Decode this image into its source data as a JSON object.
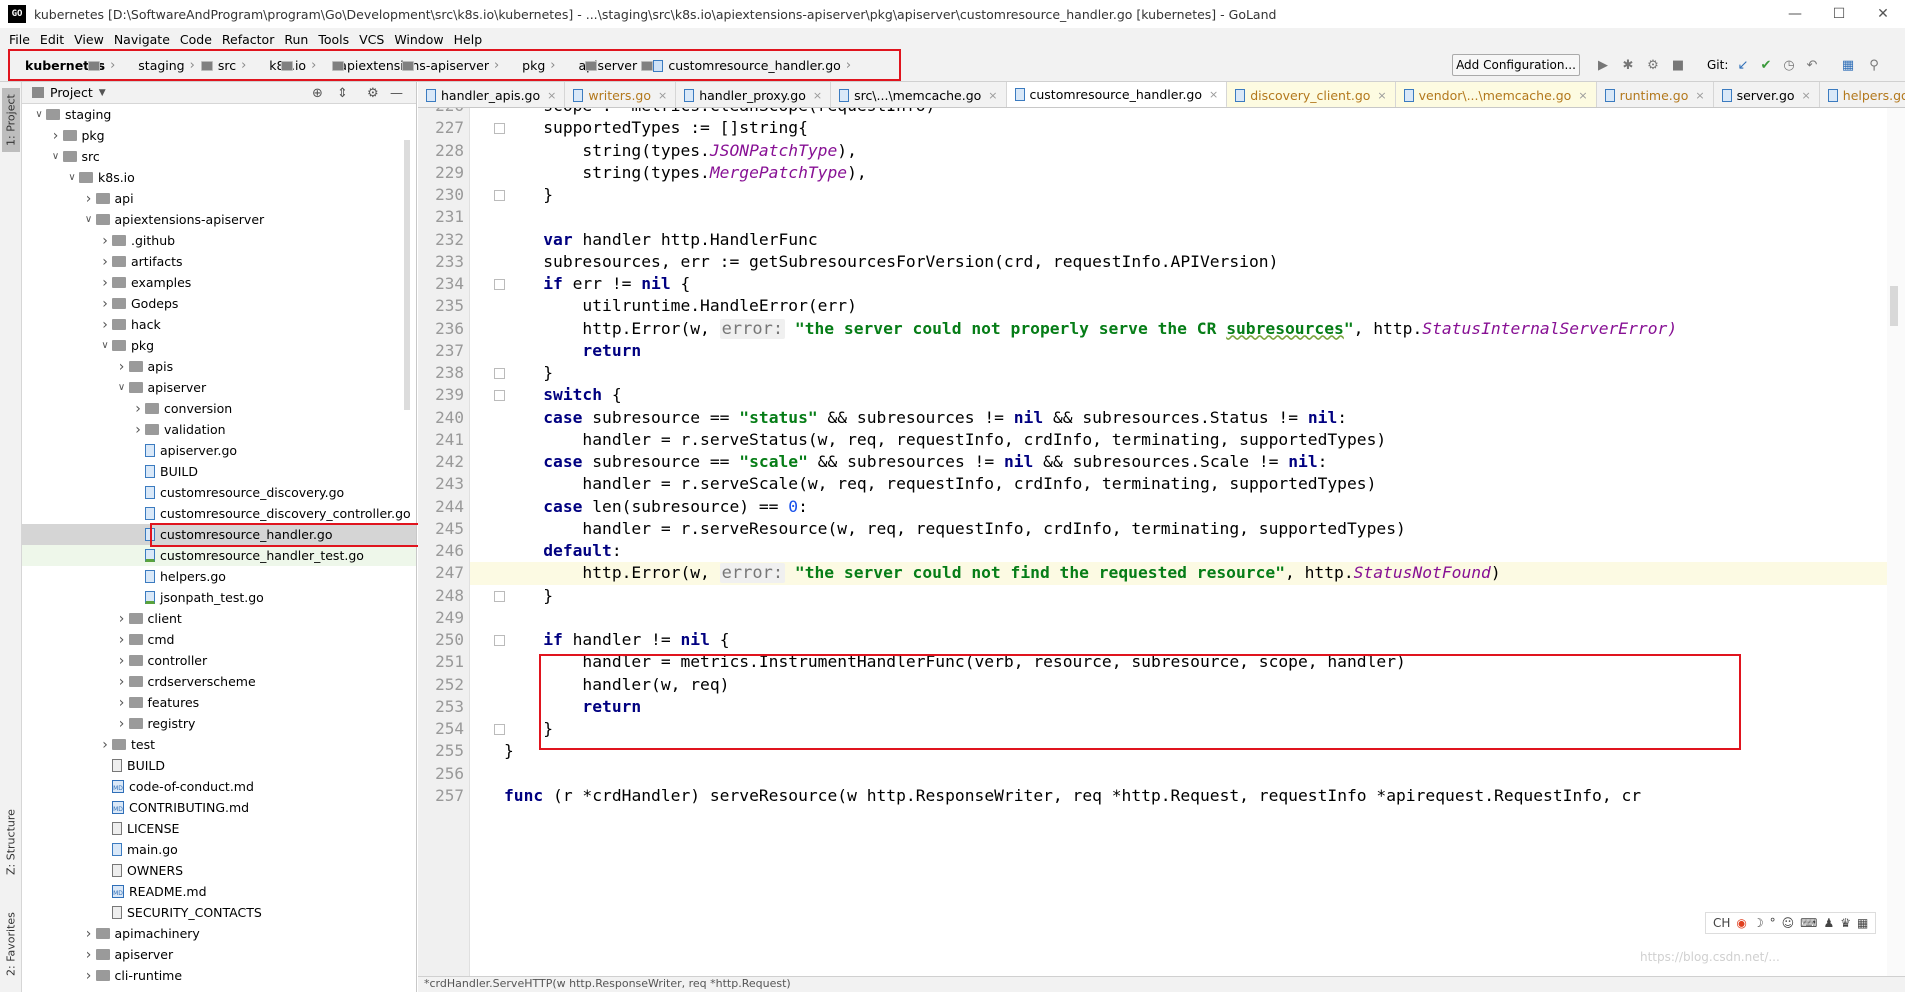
{
  "window": {
    "title": "kubernetes [D:\\SoftwareAndProgram\\program\\Go\\Development\\src\\k8s.io\\kubernetes] - ...\\staging\\src\\k8s.io\\apiextensions-apiserver\\pkg\\apiserver\\customresource_handler.go [kubernetes] - GoLand",
    "app_icon": "GO"
  },
  "menu": [
    "File",
    "Edit",
    "View",
    "Navigate",
    "Code",
    "Refactor",
    "Run",
    "Tools",
    "VCS",
    "Window",
    "Help"
  ],
  "breadcrumbs": [
    "kubernetes",
    "staging",
    "src",
    "k8s.io",
    "apiextensions-apiserver",
    "pkg",
    "apiserver",
    "customresource_handler.go"
  ],
  "toolbar": {
    "add_config": "Add Configuration...",
    "git_label": "Git:"
  },
  "side_tabs": {
    "project": "1: Project",
    "structure": "Z: Structure",
    "favorites": "2: Favorites"
  },
  "project_panel": {
    "title": "Project"
  },
  "tree": [
    {
      "indent": 0,
      "arrow": "v",
      "icon": "folder",
      "label": "staging"
    },
    {
      "indent": 1,
      "arrow": ">",
      "icon": "folder",
      "label": "pkg"
    },
    {
      "indent": 1,
      "arrow": "v",
      "icon": "folder",
      "label": "src"
    },
    {
      "indent": 2,
      "arrow": "v",
      "icon": "folder",
      "label": "k8s.io"
    },
    {
      "indent": 3,
      "arrow": ">",
      "icon": "folder",
      "label": "api"
    },
    {
      "indent": 3,
      "arrow": "v",
      "icon": "folder",
      "label": "apiextensions-apiserver"
    },
    {
      "indent": 4,
      "arrow": ">",
      "icon": "folder",
      "label": ".github"
    },
    {
      "indent": 4,
      "arrow": ">",
      "icon": "folder",
      "label": "artifacts"
    },
    {
      "indent": 4,
      "arrow": ">",
      "icon": "folder",
      "label": "examples"
    },
    {
      "indent": 4,
      "arrow": ">",
      "icon": "folder",
      "label": "Godeps"
    },
    {
      "indent": 4,
      "arrow": ">",
      "icon": "folder",
      "label": "hack"
    },
    {
      "indent": 4,
      "arrow": "v",
      "icon": "folder",
      "label": "pkg"
    },
    {
      "indent": 5,
      "arrow": ">",
      "icon": "folder",
      "label": "apis"
    },
    {
      "indent": 5,
      "arrow": "v",
      "icon": "folder",
      "label": "apiserver"
    },
    {
      "indent": 6,
      "arrow": ">",
      "icon": "folder",
      "label": "conversion"
    },
    {
      "indent": 6,
      "arrow": ">",
      "icon": "folder",
      "label": "validation"
    },
    {
      "indent": 6,
      "arrow": "",
      "icon": "go",
      "label": "apiserver.go"
    },
    {
      "indent": 6,
      "arrow": "",
      "icon": "go",
      "label": "BUILD"
    },
    {
      "indent": 6,
      "arrow": "",
      "icon": "go",
      "label": "customresource_discovery.go"
    },
    {
      "indent": 6,
      "arrow": "",
      "icon": "go",
      "label": "customresource_discovery_controller.go"
    },
    {
      "indent": 6,
      "arrow": "",
      "icon": "go",
      "label": "customresource_handler.go",
      "state": "sel"
    },
    {
      "indent": 6,
      "arrow": "",
      "icon": "gotest",
      "label": "customresource_handler_test.go",
      "state": "test"
    },
    {
      "indent": 6,
      "arrow": "",
      "icon": "go",
      "label": "helpers.go"
    },
    {
      "indent": 6,
      "arrow": "",
      "icon": "gotest",
      "label": "jsonpath_test.go"
    },
    {
      "indent": 5,
      "arrow": ">",
      "icon": "folder",
      "label": "client"
    },
    {
      "indent": 5,
      "arrow": ">",
      "icon": "folder",
      "label": "cmd"
    },
    {
      "indent": 5,
      "arrow": ">",
      "icon": "folder",
      "label": "controller"
    },
    {
      "indent": 5,
      "arrow": ">",
      "icon": "folder",
      "label": "crdserverscheme"
    },
    {
      "indent": 5,
      "arrow": ">",
      "icon": "folder",
      "label": "features"
    },
    {
      "indent": 5,
      "arrow": ">",
      "icon": "folder",
      "label": "registry"
    },
    {
      "indent": 4,
      "arrow": ">",
      "icon": "folder",
      "label": "test"
    },
    {
      "indent": 4,
      "arrow": "",
      "icon": "text",
      "label": "BUILD"
    },
    {
      "indent": 4,
      "arrow": "",
      "icon": "md",
      "label": "code-of-conduct.md"
    },
    {
      "indent": 4,
      "arrow": "",
      "icon": "md",
      "label": "CONTRIBUTING.md"
    },
    {
      "indent": 4,
      "arrow": "",
      "icon": "text",
      "label": "LICENSE"
    },
    {
      "indent": 4,
      "arrow": "",
      "icon": "go",
      "label": "main.go"
    },
    {
      "indent": 4,
      "arrow": "",
      "icon": "text",
      "label": "OWNERS"
    },
    {
      "indent": 4,
      "arrow": "",
      "icon": "md",
      "label": "README.md"
    },
    {
      "indent": 4,
      "arrow": "",
      "icon": "text",
      "label": "SECURITY_CONTACTS"
    },
    {
      "indent": 3,
      "arrow": ">",
      "icon": "folder",
      "label": "apimachinery"
    },
    {
      "indent": 3,
      "arrow": ">",
      "icon": "folder",
      "label": "apiserver"
    },
    {
      "indent": 3,
      "arrow": ">",
      "icon": "folder",
      "label": "cli-runtime"
    }
  ],
  "tabs": [
    {
      "label": "handler_apis.go",
      "state": ""
    },
    {
      "label": "writers.go",
      "state": "mod"
    },
    {
      "label": "handler_proxy.go",
      "state": ""
    },
    {
      "label": "src\\...\\memcache.go",
      "state": ""
    },
    {
      "label": "customresource_handler.go",
      "state": "active"
    },
    {
      "label": "discovery_client.go",
      "state": "mod yel"
    },
    {
      "label": "vendor\\...\\memcache.go",
      "state": "mod yel"
    },
    {
      "label": "runtime.go",
      "state": "mod"
    },
    {
      "label": "server.go",
      "state": ""
    },
    {
      "label": "helpers.go",
      "state": "mod"
    }
  ],
  "code": [
    {
      "n": "226",
      "t": [
        [
          "    scope := metrics.CleanScope(requestInfo)",
          ""
        ]
      ]
    },
    {
      "n": "227",
      "t": [
        [
          "    supportedTypes := []string{",
          ""
        ]
      ]
    },
    {
      "n": "228",
      "t": [
        [
          "        string(types.",
          ""
        ],
        [
          "JSONPatchType",
          "ty"
        ],
        [
          "),",
          ""
        ]
      ]
    },
    {
      "n": "229",
      "t": [
        [
          "        string(types.",
          ""
        ],
        [
          "MergePatchType",
          "ty"
        ],
        [
          "),",
          ""
        ]
      ]
    },
    {
      "n": "230",
      "t": [
        [
          "    }",
          ""
        ]
      ]
    },
    {
      "n": "231",
      "t": []
    },
    {
      "n": "232",
      "t": [
        [
          "    ",
          ""
        ],
        [
          "var",
          "kw"
        ],
        [
          " handler http.HandlerFunc",
          ""
        ]
      ]
    },
    {
      "n": "233",
      "t": [
        [
          "    subresources, err := getSubresourcesForVersion(crd, requestInfo.APIVersion)",
          ""
        ]
      ]
    },
    {
      "n": "234",
      "t": [
        [
          "    ",
          ""
        ],
        [
          "if",
          "kw"
        ],
        [
          " err != ",
          ""
        ],
        [
          "nil",
          "kw"
        ],
        [
          " {",
          ""
        ]
      ]
    },
    {
      "n": "235",
      "t": [
        [
          "        utilruntime.HandleError(err)",
          ""
        ]
      ]
    },
    {
      "n": "236",
      "t": [
        [
          "        http.Error(w, ",
          ""
        ],
        [
          "error:",
          "hint"
        ],
        [
          " ",
          ""
        ],
        [
          "\"the server could not properly serve the CR ",
          "str"
        ],
        [
          "subresources",
          "str wav"
        ],
        [
          "\"",
          "str"
        ],
        [
          ", http.",
          ""
        ],
        [
          "StatusInternalServerError)",
          "ty"
        ]
      ]
    },
    {
      "n": "237",
      "t": [
        [
          "        ",
          ""
        ],
        [
          "return",
          "kw"
        ]
      ]
    },
    {
      "n": "238",
      "t": [
        [
          "    }",
          ""
        ]
      ]
    },
    {
      "n": "239",
      "t": [
        [
          "    ",
          ""
        ],
        [
          "switch",
          "kw"
        ],
        [
          " {",
          ""
        ]
      ]
    },
    {
      "n": "240",
      "t": [
        [
          "    ",
          ""
        ],
        [
          "case",
          "kw"
        ],
        [
          " subresource == ",
          ""
        ],
        [
          "\"status\"",
          "str"
        ],
        [
          " && subresources != ",
          ""
        ],
        [
          "nil",
          "kw"
        ],
        [
          " && subresources.Status != ",
          ""
        ],
        [
          "nil",
          "kw"
        ],
        [
          ":",
          ""
        ]
      ]
    },
    {
      "n": "241",
      "t": [
        [
          "        handler = r.serveStatus(w, req, requestInfo, crdInfo, terminating, supportedTypes)",
          ""
        ]
      ]
    },
    {
      "n": "242",
      "t": [
        [
          "    ",
          ""
        ],
        [
          "case",
          "kw"
        ],
        [
          " subresource == ",
          ""
        ],
        [
          "\"scale\"",
          "str"
        ],
        [
          " && subresources != ",
          ""
        ],
        [
          "nil",
          "kw"
        ],
        [
          " && subresources.Scale != ",
          ""
        ],
        [
          "nil",
          "kw"
        ],
        [
          ":",
          ""
        ]
      ]
    },
    {
      "n": "243",
      "t": [
        [
          "        handler = r.serveScale(w, req, requestInfo, crdInfo, terminating, supportedTypes)",
          ""
        ]
      ]
    },
    {
      "n": "244",
      "t": [
        [
          "    ",
          ""
        ],
        [
          "case",
          "kw"
        ],
        [
          " len(subresource) == ",
          ""
        ],
        [
          "0",
          "num"
        ],
        [
          ":",
          ""
        ]
      ]
    },
    {
      "n": "245",
      "t": [
        [
          "        handler = r.serveResource(w, req, requestInfo, crdInfo, terminating, supportedTypes)",
          ""
        ]
      ]
    },
    {
      "n": "246",
      "t": [
        [
          "    ",
          ""
        ],
        [
          "default",
          "kw"
        ],
        [
          ":",
          ""
        ]
      ]
    },
    {
      "n": "247",
      "t": [
        [
          "        http.Error(w, ",
          ""
        ],
        [
          "error:",
          "hint"
        ],
        [
          " ",
          ""
        ],
        [
          "\"the server could not find the requested resource\"",
          "str"
        ],
        [
          ", http.",
          ""
        ],
        [
          "StatusNotFound",
          "ty"
        ],
        [
          ")",
          ""
        ]
      ],
      "cur": true
    },
    {
      "n": "248",
      "t": [
        [
          "    }",
          ""
        ]
      ]
    },
    {
      "n": "249",
      "t": []
    },
    {
      "n": "250",
      "t": [
        [
          "    ",
          ""
        ],
        [
          "if",
          "kw"
        ],
        [
          " handler != ",
          ""
        ],
        [
          "nil",
          "kw"
        ],
        [
          " {",
          ""
        ]
      ]
    },
    {
      "n": "251",
      "t": [
        [
          "        handler = metrics.InstrumentHandlerFunc(verb, resource, subresource, scope, handler)",
          ""
        ]
      ]
    },
    {
      "n": "252",
      "t": [
        [
          "        handler(w, req)",
          ""
        ]
      ]
    },
    {
      "n": "253",
      "t": [
        [
          "        ",
          ""
        ],
        [
          "return",
          "kw"
        ]
      ]
    },
    {
      "n": "254",
      "t": [
        [
          "    }",
          ""
        ]
      ]
    },
    {
      "n": "255",
      "t": [
        [
          "}",
          ""
        ]
      ]
    },
    {
      "n": "256",
      "t": []
    },
    {
      "n": "257",
      "t": [
        [
          "",
          ""
        ],
        [
          "func",
          "kw"
        ],
        [
          " (r *crdHandler) serveResource(w http.ResponseWriter, req *http.Request, requestInfo *apirequest.RequestInfo, cr",
          ""
        ]
      ]
    }
  ],
  "status_text": "*crdHandler.ServeHTTP(w http.ResponseWriter, req *http.Request)",
  "ime_label": "CH",
  "watermark": "https://blog.csdn.net/...",
  "colors": {
    "highlight_red": "#e0141e",
    "keyword": "#000080",
    "string": "#067d17",
    "type_italic": "#871094"
  }
}
